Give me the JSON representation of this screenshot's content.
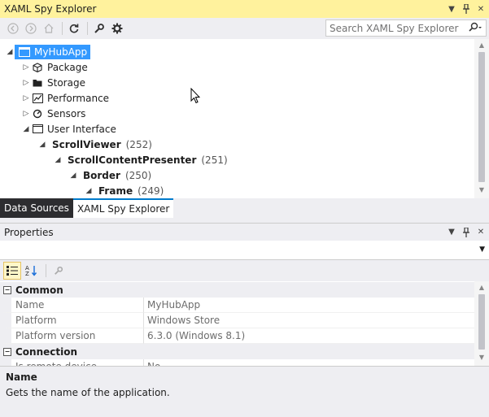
{
  "explorer": {
    "title": "XAML Spy Explorer",
    "search_placeholder": "Search XAML Spy Explorer",
    "tree": [
      {
        "label": "MyHubApp",
        "count": "",
        "bold": false,
        "selected": true,
        "expander": "◢",
        "icon": "window-icon"
      },
      {
        "label": "Package",
        "count": "",
        "bold": false,
        "selected": false,
        "expander": "▷",
        "icon": "package-icon"
      },
      {
        "label": "Storage",
        "count": "",
        "bold": false,
        "selected": false,
        "expander": "▷",
        "icon": "storage-icon"
      },
      {
        "label": "Performance",
        "count": "",
        "bold": false,
        "selected": false,
        "expander": "▷",
        "icon": "performance-icon"
      },
      {
        "label": "Sensors",
        "count": "",
        "bold": false,
        "selected": false,
        "expander": "▷",
        "icon": "sensors-icon"
      },
      {
        "label": "User Interface",
        "count": "",
        "bold": false,
        "selected": false,
        "expander": "◢",
        "icon": "user-interface-icon"
      },
      {
        "label": "ScrollViewer",
        "count": "(252)",
        "bold": true,
        "selected": false,
        "expander": "◢",
        "icon": ""
      },
      {
        "label": "ScrollContentPresenter",
        "count": "(251)",
        "bold": true,
        "selected": false,
        "expander": "◢",
        "icon": ""
      },
      {
        "label": "Border",
        "count": "(250)",
        "bold": true,
        "selected": false,
        "expander": "◢",
        "icon": ""
      },
      {
        "label": "Frame",
        "count": "(249)",
        "bold": true,
        "selected": false,
        "expander": "◢",
        "icon": ""
      }
    ]
  },
  "tabs": [
    {
      "label": "Data Sources",
      "active": false
    },
    {
      "label": "XAML Spy Explorer",
      "active": true
    }
  ],
  "properties": {
    "title": "Properties",
    "rows": [
      {
        "type": "category",
        "label": "Common",
        "toggle": "−"
      },
      {
        "type": "property",
        "name": "Name",
        "value": "MyHubApp"
      },
      {
        "type": "property",
        "name": "Platform",
        "value": "Windows Store"
      },
      {
        "type": "property",
        "name": "Platform version",
        "value": "6.3.0 (Windows 8.1)"
      },
      {
        "type": "category",
        "label": "Connection",
        "toggle": "−"
      },
      {
        "type": "property",
        "name": "Is remote device",
        "value": "No"
      }
    ],
    "description": {
      "name": "Name",
      "text": "Gets the name of the application."
    }
  },
  "colors": {
    "title_active": "#fff29d",
    "selection": "#3399ff",
    "tab_dark": "#2d2d30"
  }
}
